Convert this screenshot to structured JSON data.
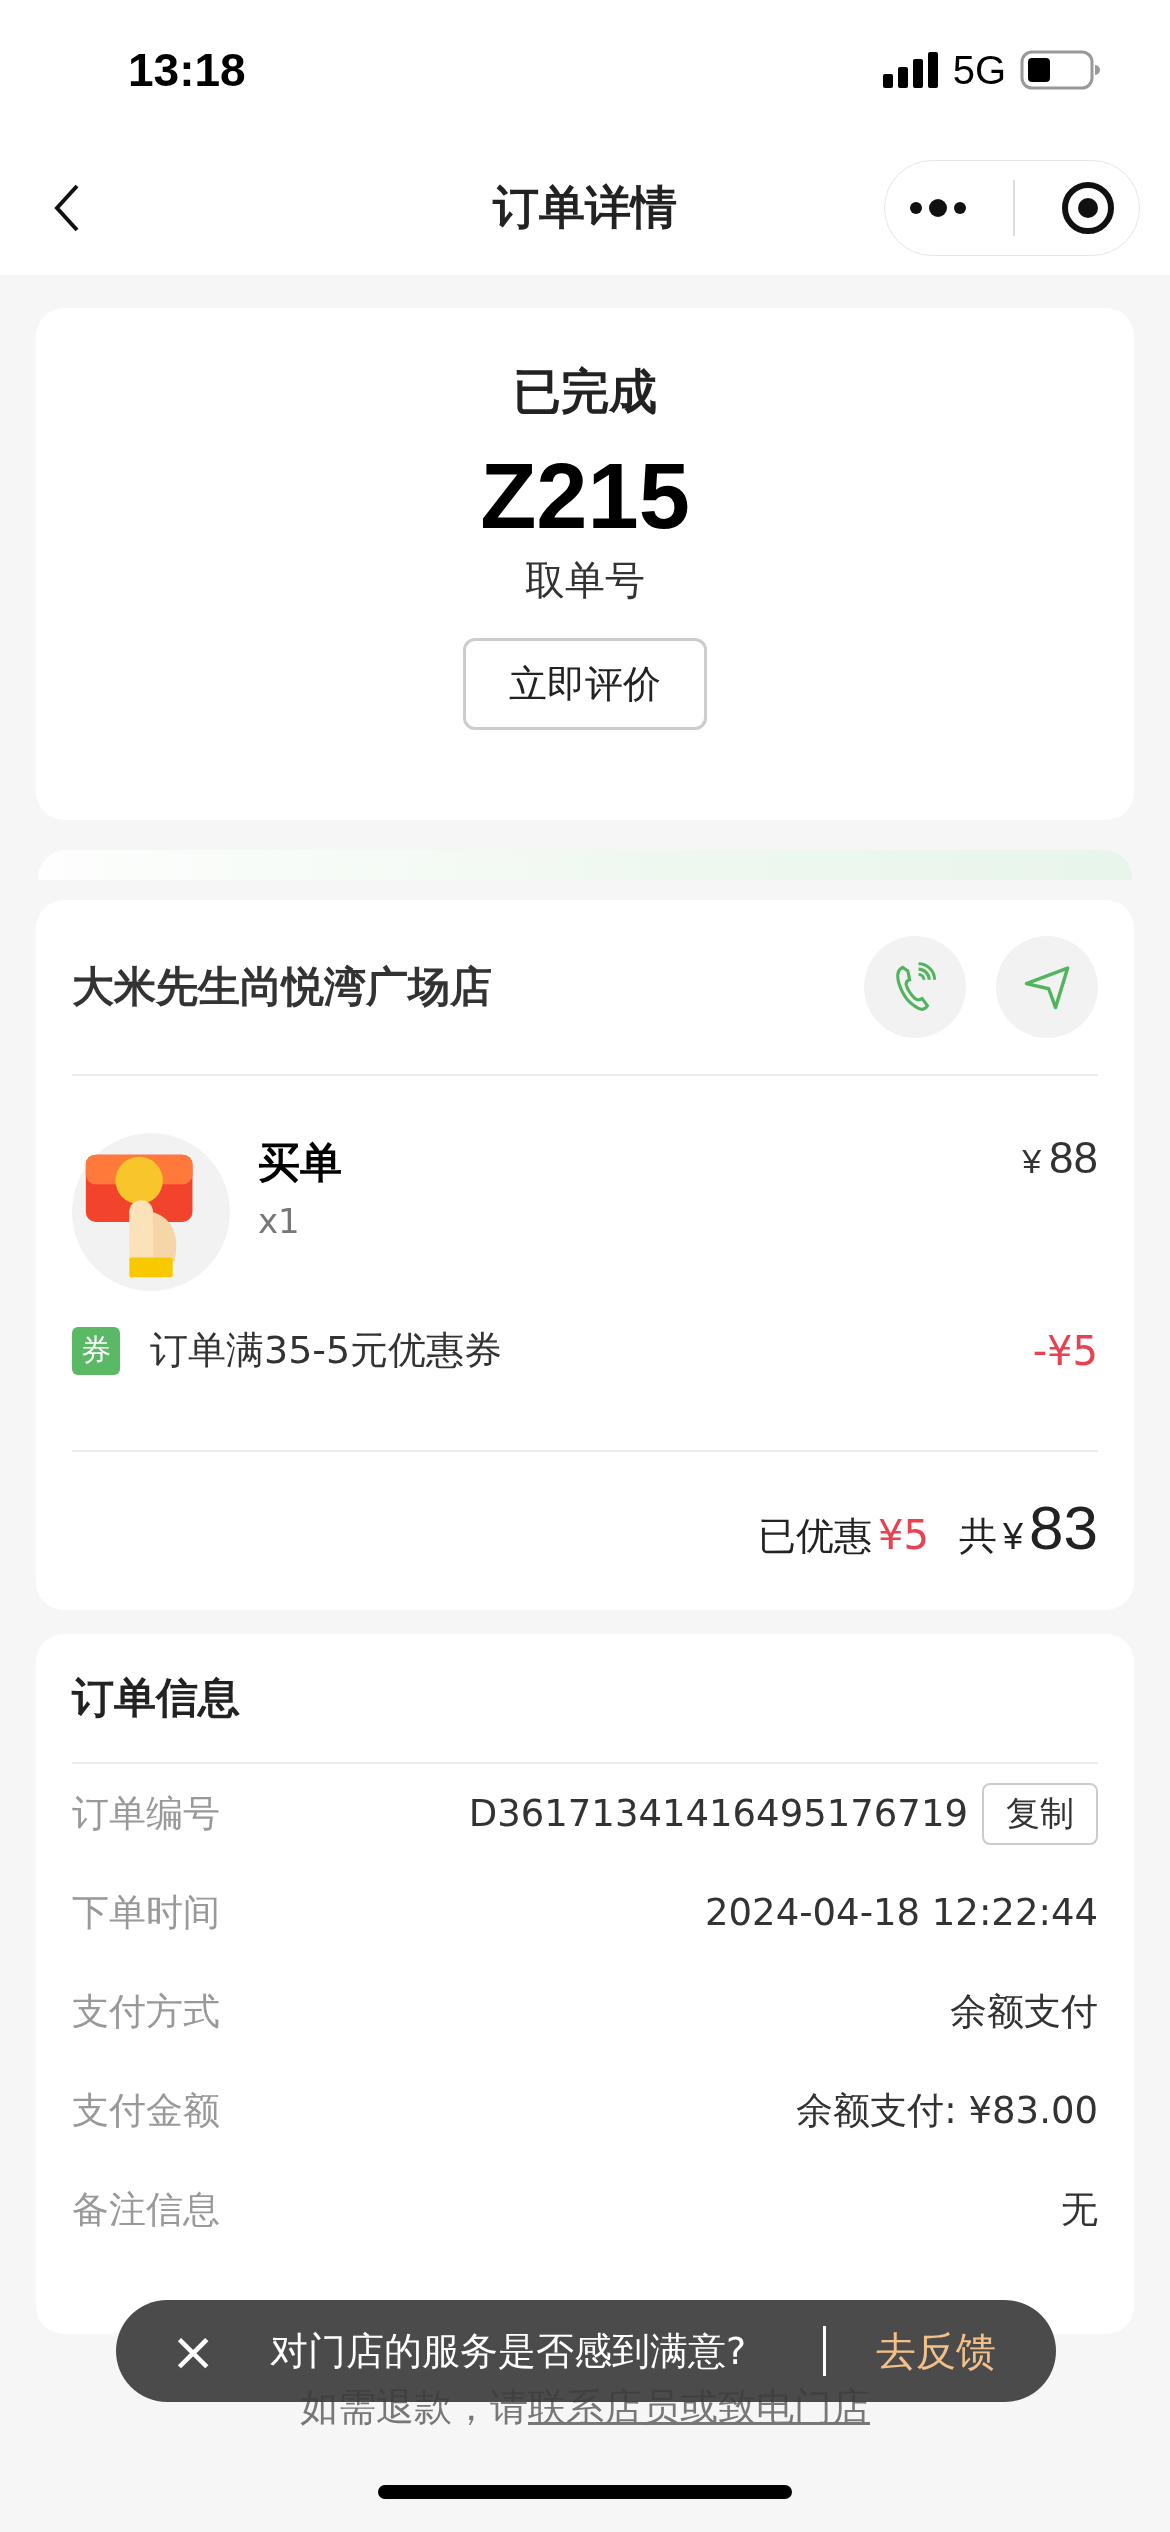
{
  "status_bar": {
    "time": "13:18",
    "network": "5G"
  },
  "nav": {
    "title": "订单详情"
  },
  "status_card": {
    "status": "已完成",
    "pickup_code": "Z215",
    "pickup_label": "取单号",
    "button": "立即评价"
  },
  "store": {
    "name": "大米先生尚悦湾广场店",
    "item": {
      "kind": "picture",
      "name": "买单",
      "quantity": "x1",
      "price": "88",
      "currency": "¥"
    },
    "coupon": {
      "tag": "券",
      "name": "订单满35-5元优惠券",
      "amount": "-¥5"
    },
    "summary": {
      "discount_label": "已优惠",
      "discount": "¥5",
      "total_label": "共",
      "currency": "¥",
      "total": "83"
    }
  },
  "order_info": {
    "title": "订单信息",
    "rows": [
      {
        "label": "订单编号",
        "value": "D36171341416495176719",
        "button": "复制"
      },
      {
        "label": "下单时间",
        "value": "2024-04-18 12:22:44"
      },
      {
        "label": "支付方式",
        "value": "余额支付"
      },
      {
        "label": "支付金额",
        "value": "余额支付: ¥83.00"
      },
      {
        "label": "备注信息",
        "value": "无"
      }
    ]
  },
  "refund_note": {
    "text": "如需退款，请",
    "link": "联系店员或致电门店"
  },
  "toast": {
    "close": "×",
    "message": "对门店的服务是否感到满意?",
    "action": "去反馈"
  }
}
